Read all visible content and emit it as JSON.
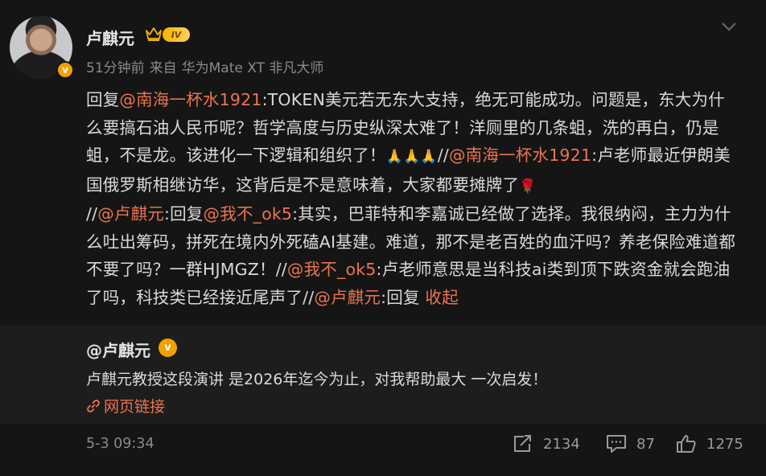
{
  "header": {
    "user_name": "卢麒元",
    "level_badge": "IV",
    "avatar_badge": "v",
    "time_ago": "51分钟前",
    "source_prefix": "来自",
    "source_device": "华为Mate XT 非凡大师"
  },
  "post": {
    "t1": "回复",
    "m1": "@南海一杯水1921",
    "t2": ":TOKEN美元若无东大支持，绝无可能成功。问题是，东大为什么要搞石油人民币呢？哲学高度与历史纵深太难了！洋厕里的几条蛆，洗的再白，仍是蛆，不是龙。该进化一下逻辑和组织了！",
    "e1": "🙏🙏🙏",
    "t3": "//",
    "m2": "@南海一杯水1921",
    "t4": ":卢老师最近伊朗美国俄罗斯相继访华，这背后是不是意味着，大家都要摊牌了",
    "e2": "🌹",
    "t5": "//",
    "m3": "@卢麒元",
    "t6": ":回复",
    "m4": "@我不_ok5",
    "t7": ":其实，巴菲特和李嘉诚已经做了选择。我很纳闷，主力为什么吐出筹码，拼死在境内外死磕AI基建。难道，那不是老百姓的血汗吗？养老保险难道都不要了吗？一群HJMGZ！",
    "t8": "//",
    "m5": "@我不_ok5",
    "t9": ":卢老师意思是当科技ai类到顶下跌资金就会跑油了吗，科技类已经接近尾声了//",
    "m6": "@卢麒元",
    "t10": ":回复 ",
    "collapse_label": "收起"
  },
  "repost": {
    "author": "@卢麒元",
    "verified_badge": "v",
    "text": "卢麒元教授这段演讲 是2026年迄今为止，对我帮助最大 一次启发！",
    "link_label": "网页链接"
  },
  "footer": {
    "timestamp": "5-3 09:34",
    "reposts": "2134",
    "comments": "87",
    "likes": "1275"
  },
  "colors": {
    "background": "#151515",
    "repost_background": "#1d1d1d",
    "mention": "#eb7350",
    "badge": "#f2a100"
  },
  "icons": [
    "crown-icon",
    "chevron-down-icon",
    "verified-icon",
    "link-icon",
    "repost-icon",
    "comment-icon",
    "like-icon"
  ]
}
